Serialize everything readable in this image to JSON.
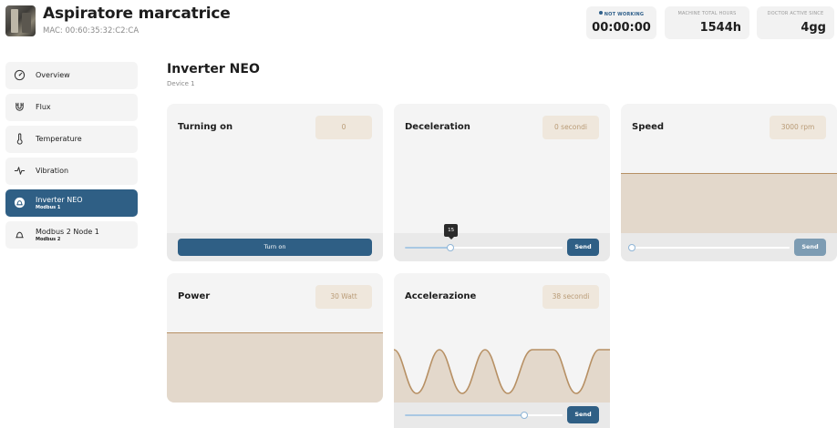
{
  "header": {
    "title": "Aspiratore marcatrice",
    "mac": "MAC: 00:60:35:32:C2:CA",
    "stats": [
      {
        "label": "NOT WORKING",
        "value": "00:00:00"
      },
      {
        "label": "MACHINE TOTAL HOURS",
        "value": "1544h"
      },
      {
        "label": "DOCTOR ACTIVE SINCE",
        "value": "4gg"
      }
    ]
  },
  "sidebar": {
    "items": [
      {
        "label": "Overview",
        "icon": "gauge-icon",
        "sub": ""
      },
      {
        "label": "Flux",
        "icon": "magnet-icon",
        "sub": ""
      },
      {
        "label": "Temperature",
        "icon": "thermometer-icon",
        "sub": ""
      },
      {
        "label": "Vibration",
        "icon": "pulse-icon",
        "sub": ""
      },
      {
        "label": "Inverter NEO",
        "icon": "inverter-icon",
        "sub": "Modbus 1",
        "active": true
      },
      {
        "label": "Modbus 2 Node 1",
        "icon": "inverter-icon",
        "sub": "Modbus 2"
      }
    ]
  },
  "main": {
    "title": "Inverter NEO",
    "subtitle": "Device 1",
    "cards": {
      "turning_on": {
        "title": "Turning on",
        "value": "0",
        "button": "Turn on"
      },
      "deceleration": {
        "title": "Deceleration",
        "value": "0 secondi",
        "button": "Send",
        "slider_tooltip": "15",
        "slider_level": 0.29
      },
      "speed": {
        "title": "Speed",
        "value": "3000 rpm",
        "button": "Send",
        "slider_level": 0.0,
        "fill_level": 0.6
      },
      "power": {
        "title": "Power",
        "value": "30 Watt",
        "fill_level": 0.5
      },
      "accelerazione": {
        "title": "Accelerazione",
        "value": "38 secondi",
        "button": "Send",
        "slider_level": 0.76
      }
    }
  },
  "colors": {
    "accent": "#2f5f85",
    "card_bg": "#f4f4f4",
    "fill": "#e3d8cb",
    "fill_line": "#b79064",
    "value_text": "#b99b76"
  }
}
